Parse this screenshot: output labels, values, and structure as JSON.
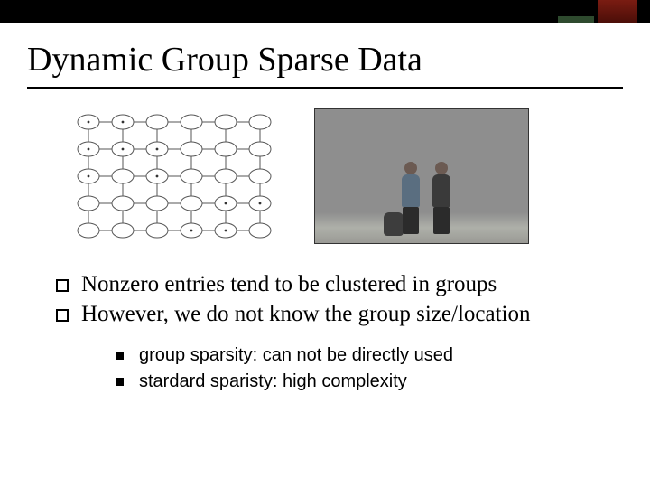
{
  "title": "Dynamic Group Sparse Data",
  "bullets": [
    "Nonzero entries tend to be clustered in groups",
    "However, we do not know the group size/location"
  ],
  "sub_bullets": [
    "group sparsity: can not be directly used",
    "stardard sparisty: high complexity"
  ],
  "figures": {
    "left": "mrf-grid-graph",
    "right": "two-pedestrians-photo"
  }
}
